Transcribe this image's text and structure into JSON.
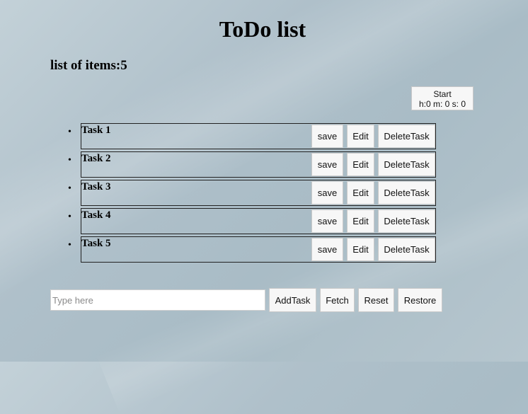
{
  "title": "ToDo list",
  "count_label": "list of items:5",
  "timer": {
    "label": "Start",
    "time": "h:0 m: 0 s: 0"
  },
  "tasks": [
    {
      "name": "Task 1",
      "save": "save",
      "edit": "Edit",
      "delete": "DeleteTask"
    },
    {
      "name": "Task 2",
      "save": "save",
      "edit": "Edit",
      "delete": "DeleteTask"
    },
    {
      "name": "Task 3",
      "save": "save",
      "edit": "Edit",
      "delete": "DeleteTask"
    },
    {
      "name": "Task 4",
      "save": "save",
      "edit": "Edit",
      "delete": "DeleteTask"
    },
    {
      "name": "Task 5",
      "save": "save",
      "edit": "Edit",
      "delete": "DeleteTask"
    }
  ],
  "bullet": "•",
  "input": {
    "placeholder": "Type here",
    "value": ""
  },
  "buttons": {
    "add": "AddTask",
    "fetch": "Fetch",
    "reset": "Reset",
    "restore": "Restore"
  }
}
